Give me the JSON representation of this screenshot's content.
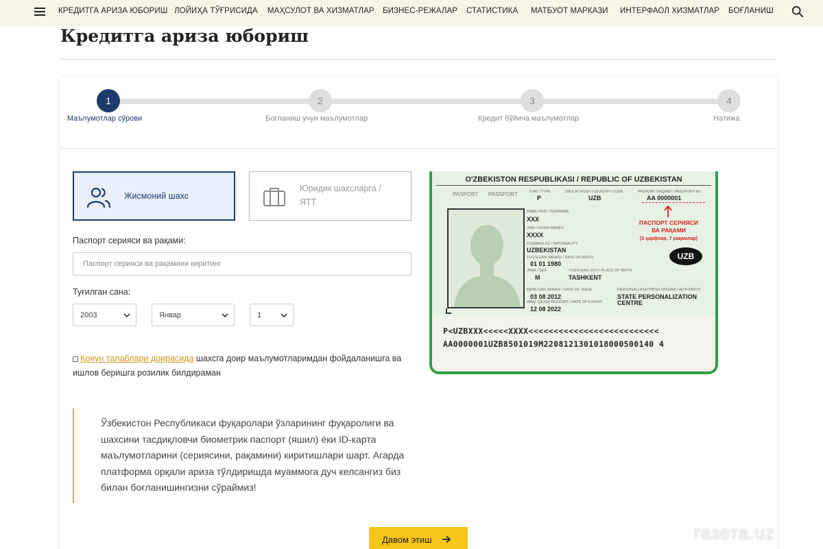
{
  "nav": {
    "items": [
      "КРЕДИТГА АРИЗА ЮБОРИШ",
      "ЛОЙИҲА ТЎҒРИСИДА",
      "МАҲСУЛОТ ВА ХИЗМАТЛАР",
      "БИЗНЕС-РЕЖАЛАР",
      "СТАТИСТИКА",
      "МАТБУОТ МАРКАЗИ",
      "ИНТЕРФАОЛ ХИЗМАТЛАР",
      "БОҒЛАНИШ"
    ]
  },
  "page": {
    "title": "Кредитга ариза юбориш"
  },
  "stepper": {
    "active_step": 1,
    "steps": [
      {
        "number": "1",
        "label": "Маълумотлар сўрови"
      },
      {
        "number": "2",
        "label": "Боғланиш учун маълумотлар"
      },
      {
        "number": "3",
        "label": "Кредит бўйича маълумотлар"
      },
      {
        "number": "4",
        "label": "Натижа"
      }
    ]
  },
  "person_type": {
    "individual_label": "Жисмоний шахс",
    "legal_label_line1": "Юридик шахсларга /",
    "legal_label_line2": "ЯТТ",
    "selected": "individual"
  },
  "form": {
    "passport_label": "Паспорт серияси ва рақами:",
    "passport_placeholder": "Паспорт серияси ва рақамини киритинг",
    "passport_value": "",
    "birthdate_label": "Туғилган сана:",
    "year": "2003",
    "month": "Январ",
    "day": "1"
  },
  "consent": {
    "link_text": "Қонун талаблари доирасида",
    "rest_text": " шахсга доир маълумотларимдан фойдаланишга ва ишлов беришга розилик билдираман",
    "checked": false
  },
  "note": {
    "text": "Ўзбекистон Республикаси фуқаролари ўзларининг фуқаролиги ва шахсини тасдиқловчи биометрик паспорт (яшил) ёки ID-карта маълумотларини (сериясини, рақамини) киритишлари шарт. Агарда платформа орқали ариза тўлдиришда муаммога дуч келсангиз биз билан боғланишингизни сўраймиз!"
  },
  "submit": {
    "label": "Давом этиш"
  },
  "passport": {
    "header": "O'ZBEKISTON RESPUBLIKASI / REPUBLIC OF UZBEKISTAN",
    "pasport_label": "PASPORT",
    "passport_label2": "PASSPORT",
    "type_caption": "TURI / TYPE",
    "type_value": "P",
    "country_caption": "DAVLAT KODI / COUNTRY CODE",
    "country_value": "UZB",
    "number_caption": "PASPORT RAQAMI / PASSPORT No.",
    "number_value": "AA 0000001",
    "surname_caption": "FAMILIYASI / SURNAME",
    "surname_value": "XXX",
    "given_caption": "ISMI / GIVEN NAMES",
    "given_value": "XXXX",
    "nationality_caption": "FUQAROLIGI / NATIONALITY",
    "nationality_value": "UZBEKISTAN",
    "dob_caption": "TUG'ILGAN SANASI / DATE OF BIRTH",
    "dob_value": "01  01  1980",
    "sex_caption": "JINSI / SEX",
    "sex_value": "M",
    "pob_caption": "TUG'ILGAN JOYI / PLACE OF BIRTH",
    "pob_value": "TASHKENT",
    "issue_caption": "BERILGAN SANASI / DATE OF ISSUE",
    "issue_value": "03  08  2012",
    "expiry_caption": "AMAL QILISH MUDDATI / DATE OF EXPIRY",
    "expiry_value": "12  08  2022",
    "authority_caption": "PERSONALLASHTIRISH ORGANI / AUTHORITY",
    "authority_value_1": "STATE PERSONALIZATION",
    "authority_value_2": "CENTRE",
    "hint_line1": "ПАСПОРТ СЕРИЯСИ",
    "hint_line2": "ВА РАҚАМИ",
    "hint_line3": "(2 ҳарфлар, 7 рақамлар)",
    "badge": "UZB",
    "mrz1": "P<UZBXXX<<<<<XXXX<<<<<<<<<<<<<<<<<<<<<<<<<<",
    "mrz2": "AA0000001UZB8501019M2208121301018000500140 4"
  },
  "watermark": "газета.uz",
  "colors": {
    "primary": "#1e3a6d",
    "accent": "#f6c517",
    "link": "#d4961f",
    "passport_green": "#2f9e47"
  },
  "icons": [
    "hamburger-icon",
    "search-icon",
    "people-icon",
    "briefcase-icon",
    "chevron-down-icon",
    "arrow-right-icon"
  ]
}
